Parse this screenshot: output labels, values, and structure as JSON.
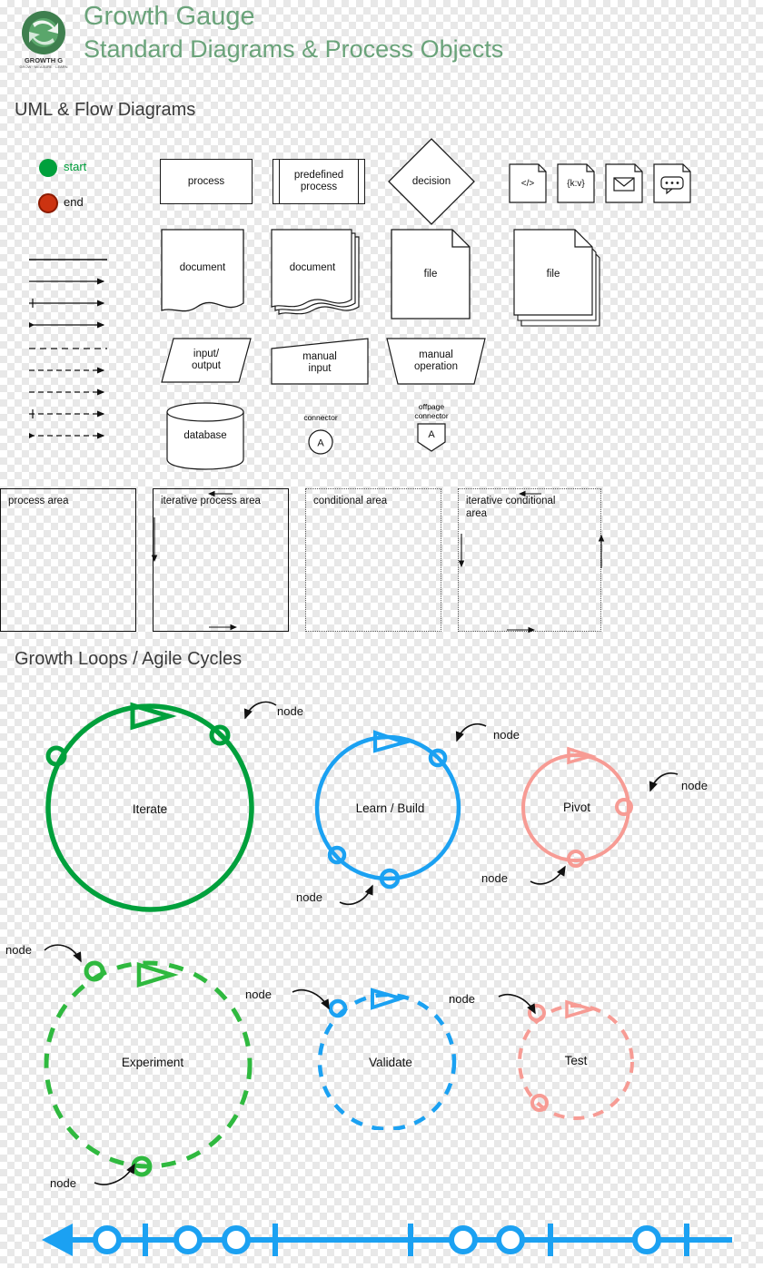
{
  "header": {
    "logo_name": "growth-gauge-logo",
    "logo_text_top": "GROWTH GAUGE",
    "logo_text_bottom": "GROW · MEASURE · LEARN",
    "title_line1": "Growth Gauge",
    "title_line2": "Standard Diagrams & Process Objects",
    "title_color": "#6aa37a"
  },
  "sections": {
    "uml": "UML & Flow Diagrams",
    "loops": "Growth Loops / Agile Cycles"
  },
  "terminators": [
    {
      "label": "start",
      "color": "#00a03c",
      "name": "start-terminator"
    },
    {
      "label": "end",
      "color": "#cc3311",
      "name": "end-terminator"
    }
  ],
  "flow_shapes": [
    {
      "name": "process-shape",
      "label": "process"
    },
    {
      "name": "predefined-process-shape",
      "label": "predefined\nprocess"
    },
    {
      "name": "decision-shape",
      "label": "decision"
    },
    {
      "name": "code-shape",
      "label": "</>"
    },
    {
      "name": "data-shape",
      "label": "{k:v}"
    },
    {
      "name": "mail-shape",
      "label": "envelope-icon"
    },
    {
      "name": "comment-shape",
      "label": "speech-bubble-icon"
    },
    {
      "name": "document-shape",
      "label": "document"
    },
    {
      "name": "multi-document-shape",
      "label": "document"
    },
    {
      "name": "file-shape",
      "label": "file"
    },
    {
      "name": "multi-file-shape",
      "label": "file"
    },
    {
      "name": "input-output-shape",
      "label": "input/\noutput"
    },
    {
      "name": "manual-input-shape",
      "label": "manual\ninput"
    },
    {
      "name": "manual-operation-shape",
      "label": "manual\noperation"
    },
    {
      "name": "database-shape",
      "label": "database"
    },
    {
      "name": "connector-shape",
      "label": "connector",
      "inner": "A"
    },
    {
      "name": "offpage-connector-shape",
      "label": "offpage\nconnector",
      "inner": "A"
    }
  ],
  "areas": [
    {
      "name": "process-area",
      "label": "process area",
      "style": "solid"
    },
    {
      "name": "iterative-process-area",
      "label": "iterative process area",
      "style": "solid"
    },
    {
      "name": "conditional-area",
      "label": "conditional area",
      "style": "dotted"
    },
    {
      "name": "iterative-conditional-area",
      "label": "iterative conditional\narea",
      "style": "dotted"
    }
  ],
  "cycles": [
    {
      "name": "iterate-cycle",
      "label": "Iterate",
      "color": "#00a03c",
      "style": "solid",
      "node_labels": [
        "node"
      ]
    },
    {
      "name": "learn-build-cycle",
      "label": "Learn / Build",
      "color": "#1ba1f2",
      "style": "solid",
      "node_labels": [
        "node",
        "node"
      ]
    },
    {
      "name": "pivot-cycle",
      "label": "Pivot",
      "color": "#f79b94",
      "style": "solid",
      "node_labels": [
        "node",
        "node"
      ]
    },
    {
      "name": "experiment-cycle",
      "label": "Experiment",
      "color": "#2fb93f",
      "style": "dashed",
      "node_labels": [
        "node",
        "node"
      ]
    },
    {
      "name": "validate-cycle",
      "label": "Validate",
      "color": "#1ba1f2",
      "style": "dashed",
      "node_labels": [
        "node"
      ]
    },
    {
      "name": "test-cycle",
      "label": "Test",
      "color": "#f79b94",
      "style": "dashed",
      "node_labels": [
        "node"
      ]
    }
  ],
  "timeline": {
    "name": "timeline-bar",
    "color": "#1ba1f2"
  }
}
